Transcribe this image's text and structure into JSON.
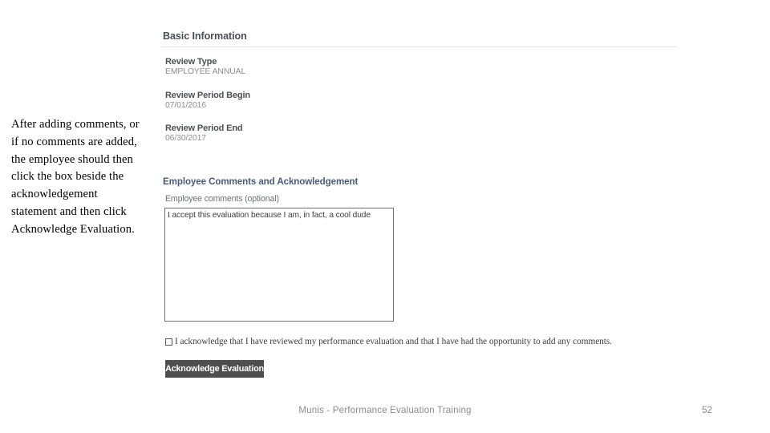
{
  "slide": {
    "instruction_text": "After adding comments, or if no comments are added, the employee should then click the box beside the acknowledgement statement and then click Acknowledge Evaluation.",
    "footer_title": "Munis - Performance Evaluation Training",
    "page_number": "52"
  },
  "screenshot": {
    "basic_information": {
      "heading": "Basic Information",
      "fields": [
        {
          "label": "Review Type",
          "value": "EMPLOYEE ANNUAL"
        },
        {
          "label": "Review Period Begin",
          "value": "07/01/2016"
        },
        {
          "label": "Review Period End",
          "value": "06/30/2017"
        }
      ]
    },
    "employee_comments": {
      "heading": "Employee Comments and Acknowledgement",
      "field_label": "Employee comments (optional)",
      "textarea_value": "I accept this evaluation because I am, in fact, a cool dude",
      "textarea_placeholder": "",
      "acknowledgement_statement": "I acknowledge that I have reviewed my performance evaluation and that I have had the opportunity to add any comments.",
      "acknowledgement_checked": false,
      "submit_label": "Acknowledge Evaluation"
    }
  },
  "colors": {
    "heading_gray": "#4a4f55",
    "heading_blue": "#4a5a7a",
    "button_bg": "#4f4f4f",
    "value_gray": "#8d8d8d",
    "footer_gray": "#8c8c8c"
  }
}
